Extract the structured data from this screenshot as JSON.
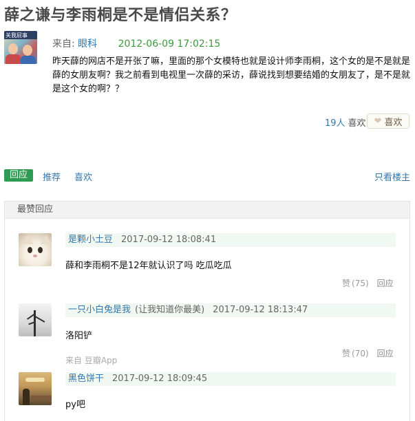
{
  "post": {
    "title": "薛之谦与李雨桐是不是情侣关系？",
    "avatar_text": "关我屁事",
    "from_label": "来自:",
    "author": "眼科",
    "timestamp": "2012-06-09 17:02:15",
    "content": "昨天薛的网店不是开张了嘛，里面的那个女模特也就是设计师李雨桐，这个女的是不是就是薛的女朋友啊？我之前看到电视里一次薛的采访，薛说找到想要结婚的女朋友了，是不是就是这个女的啊？？",
    "like_count": "19人",
    "like_count_suffix": "喜欢",
    "like_button_label": "喜欢"
  },
  "action_bar": {
    "reply_tab": "回应",
    "recommend": "推荐",
    "like": "喜欢",
    "only_op": "只看楼主"
  },
  "comments_section": {
    "header": "最赞回应",
    "comments": [
      {
        "name": "是颗小土豆",
        "signature": "",
        "timestamp": "2017-09-12 18:08:41",
        "text": "薛和李雨桐不是12年就认识了吗 吃瓜吃瓜",
        "source": "",
        "vote_label": "赞",
        "vote_count": "(75)",
        "reply_label": "回应"
      },
      {
        "name": "一只小白兔是我",
        "signature": "(让我知道你最美)",
        "timestamp": "2017-09-12 18:13:47",
        "text": "洛阳铲",
        "source": "来自 豆瓣App",
        "vote_label": "赞",
        "vote_count": "(70)",
        "reply_label": "回应"
      },
      {
        "name": "黑色饼干",
        "signature": "",
        "timestamp": "2017-09-12 18:09:45",
        "text": "py吧"
      }
    ]
  }
}
